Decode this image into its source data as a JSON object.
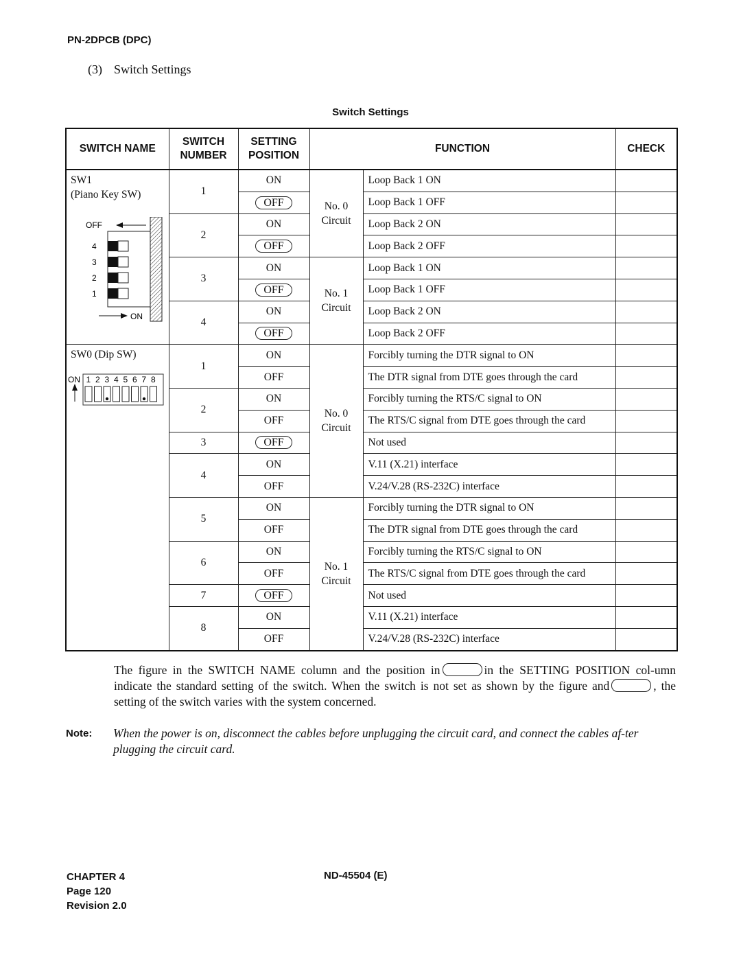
{
  "header": {
    "doc_title": "PN-2DPCB (DPC)"
  },
  "section": {
    "number": "(3)",
    "title": "Switch Settings"
  },
  "table": {
    "caption": "Switch Settings",
    "columns": [
      "SWITCH NAME",
      "SWITCH NUMBER",
      "SETTING POSITION",
      "FUNCTION",
      "CHECK"
    ],
    "columns_split": {
      "switch_number": [
        "SWITCH",
        "NUMBER"
      ],
      "setting_position": [
        "SETTING",
        "POSITION"
      ]
    },
    "sw1": {
      "name": "SW1",
      "subname": "(Piano Key SW)",
      "figure": {
        "off_label": "OFF",
        "on_label": "ON",
        "key_labels": [
          "4",
          "3",
          "2",
          "1"
        ]
      },
      "circuits": [
        "No. 0 Circuit",
        "No. 1 Circuit"
      ],
      "circuit_lines": [
        [
          "No. 0",
          "Circuit"
        ],
        [
          "No. 1",
          "Circuit"
        ]
      ],
      "rows": [
        {
          "number": "1",
          "position": "ON",
          "standard": false,
          "function": "Loop Back 1 ON"
        },
        {
          "number": "1",
          "position": "OFF",
          "standard": true,
          "function": "Loop Back 1 OFF"
        },
        {
          "number": "2",
          "position": "ON",
          "standard": false,
          "function": "Loop Back 2 ON"
        },
        {
          "number": "2",
          "position": "OFF",
          "standard": true,
          "function": "Loop Back 2 OFF"
        },
        {
          "number": "3",
          "position": "ON",
          "standard": false,
          "function": "Loop Back 1 ON"
        },
        {
          "number": "3",
          "position": "OFF",
          "standard": true,
          "function": "Loop Back 1 OFF"
        },
        {
          "number": "4",
          "position": "ON",
          "standard": false,
          "function": "Loop Back 2 ON"
        },
        {
          "number": "4",
          "position": "OFF",
          "standard": true,
          "function": "Loop Back 2 OFF"
        }
      ]
    },
    "sw0": {
      "name": "SW0 (Dip SW)",
      "figure": {
        "on_label": "ON",
        "switch_labels": [
          "1",
          "2",
          "3",
          "4",
          "5",
          "6",
          "7",
          "8"
        ],
        "on_positions": [
          3,
          7
        ]
      },
      "circuit_lines": [
        [
          "No. 0",
          "Circuit"
        ],
        [
          "No. 1",
          "Circuit"
        ]
      ],
      "rows": [
        {
          "number": "1",
          "position": "ON",
          "standard": false,
          "function": "Forcibly turning the DTR signal to ON"
        },
        {
          "number": "1",
          "position": "OFF",
          "standard": false,
          "function": "The DTR signal from DTE goes through the card"
        },
        {
          "number": "2",
          "position": "ON",
          "standard": false,
          "function": "Forcibly turning the RTS/C signal to ON"
        },
        {
          "number": "2",
          "position": "OFF",
          "standard": false,
          "function": "The RTS/C signal from DTE goes through the card"
        },
        {
          "number": "3",
          "position": "OFF",
          "standard": true,
          "function": "Not used"
        },
        {
          "number": "4",
          "position": "ON",
          "standard": false,
          "function": "V.11 (X.21) interface"
        },
        {
          "number": "4",
          "position": "OFF",
          "standard": false,
          "function": "V.24/V.28 (RS-232C) interface"
        },
        {
          "number": "5",
          "position": "ON",
          "standard": false,
          "function": "Forcibly turning the DTR signal to ON"
        },
        {
          "number": "5",
          "position": "OFF",
          "standard": false,
          "function": "The DTR signal from DTE goes through the card"
        },
        {
          "number": "6",
          "position": "ON",
          "standard": false,
          "function": "Forcibly turning the RTS/C signal to ON"
        },
        {
          "number": "6",
          "position": "OFF",
          "standard": false,
          "function": "The RTS/C signal from DTE goes through the card"
        },
        {
          "number": "7",
          "position": "OFF",
          "standard": true,
          "function": "Not used"
        },
        {
          "number": "8",
          "position": "ON",
          "standard": false,
          "function": "V.11 (X.21) interface"
        },
        {
          "number": "8",
          "position": "OFF",
          "standard": false,
          "function": "V.24/V.28 (RS-232C) interface"
        }
      ]
    }
  },
  "explanation": {
    "part1": "The figure in the SWITCH NAME column and the position in",
    "part2": "in the SETTING POSITION col-umn indicate the standard setting of the switch. When the switch is not set as shown by the figure and",
    "part3": ", the setting of the switch varies with the system concerned."
  },
  "note": {
    "label": "Note:",
    "text": "When the power is on, disconnect the cables before unplugging the circuit card, and connect the cables af-ter plugging the circuit card."
  },
  "footer": {
    "chapter": "CHAPTER 4",
    "page": "Page 120",
    "revision": "Revision 2.0",
    "doc_number": "ND-45504 (E)"
  }
}
